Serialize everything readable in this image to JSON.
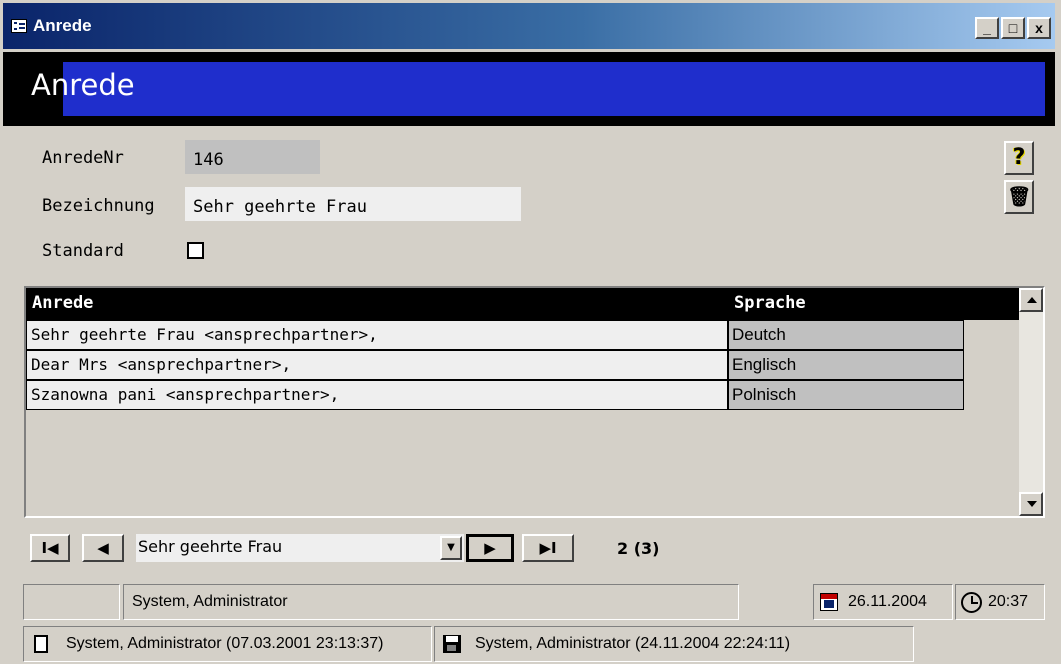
{
  "window": {
    "title": "Anrede",
    "minimize_glyph": "_",
    "maximize_glyph": "□",
    "close_glyph": "x"
  },
  "header": {
    "title": "Anrede"
  },
  "form": {
    "anredenr_label": "AnredeNr",
    "anredenr_value": "146",
    "bezeichnung_label": "Bezeichnung",
    "bezeichnung_value": "Sehr geehrte Frau",
    "standard_label": "Standard",
    "standard_checked": false
  },
  "side_buttons": {
    "help_glyph": "?",
    "delete_glyph": "🗑"
  },
  "grid": {
    "columns": [
      "Anrede",
      "Sprache"
    ],
    "rows": [
      [
        "Sehr geehrte Frau <ansprechpartner>,",
        "Deutch"
      ],
      [
        "Dear Mrs <ansprechpartner>,",
        "Englisch"
      ],
      [
        "Szanowna pani <ansprechpartner>,",
        "Polnisch"
      ]
    ]
  },
  "navigation": {
    "first_glyph": "I◀",
    "prev_glyph": "◀",
    "current_value": "Sehr geehrte Frau",
    "next_glyph": "▶",
    "last_glyph": "▶I",
    "counter": "2 (3)"
  },
  "status": {
    "user": "System, Administrator",
    "date": "26.11.2004",
    "time": "20:37",
    "created": "System, Administrator (07.03.2001 23:13:37)",
    "modified": "System, Administrator (24.11.2004 22:24:11)"
  },
  "colors": {
    "header_band": "#1f2ecc",
    "window_bg": "#d4d0c8"
  }
}
